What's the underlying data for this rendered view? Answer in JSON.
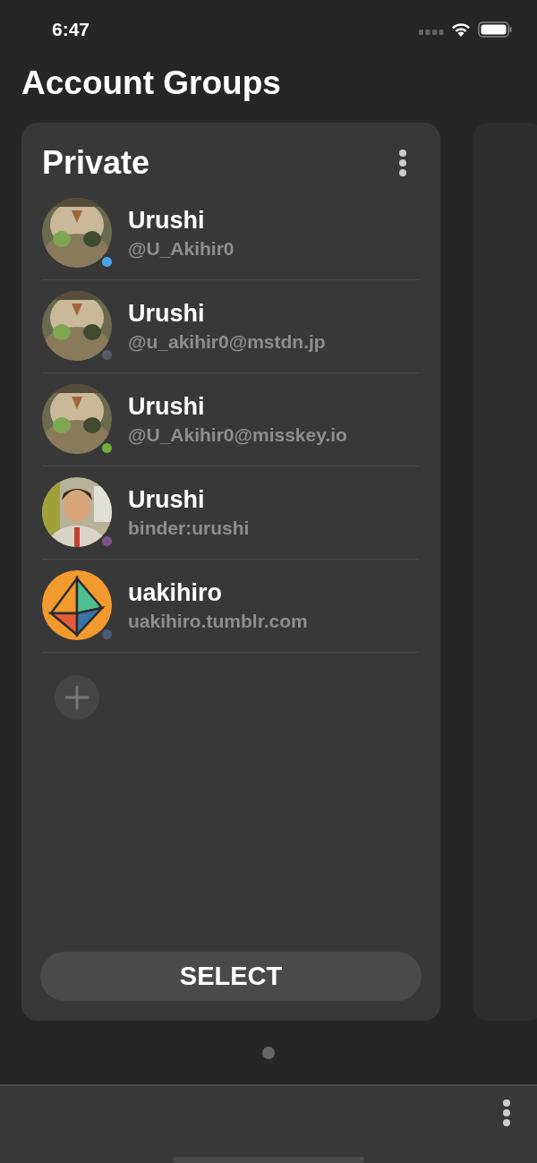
{
  "status_bar": {
    "time": "6:47"
  },
  "title": "Account Groups",
  "group": {
    "name": "Private",
    "accounts": [
      {
        "name": "Urushi",
        "handle": "@U_Akihir0",
        "kind": "picture",
        "color": "#4aa3e8"
      },
      {
        "name": "Urushi",
        "handle": "@u_akihir0@mstdn.jp",
        "kind": "picture",
        "color": "#545a66"
      },
      {
        "name": "Urushi",
        "handle": "@U_Akihir0@misskey.io",
        "kind": "picture",
        "color": "#6fae3a"
      },
      {
        "name": "Urushi",
        "handle": "binder:urushi",
        "kind": "picture",
        "color": "#7b5584"
      },
      {
        "name": "uakihiro",
        "handle": "uakihiro.tumblr.com",
        "kind": "logo",
        "color": "#4b5a75"
      }
    ],
    "select_button": "SELECT"
  }
}
